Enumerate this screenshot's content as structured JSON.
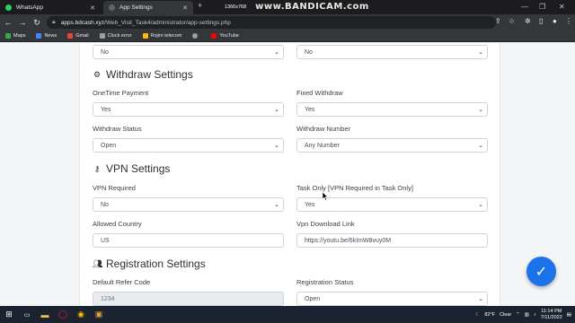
{
  "browser": {
    "tabs": [
      {
        "title": "WhatsApp",
        "active": false,
        "favicon_color": "#25d366"
      },
      {
        "title": "App Settings",
        "active": true,
        "favicon_color": "#5f6368"
      }
    ],
    "new_tab": "+",
    "url_domain": "apps.bdcash.xyz",
    "url_path": "/Web_Visit_Task4/administrator/app-settings.php",
    "bookmarks": [
      {
        "label": "Maps",
        "color": "#34a853"
      },
      {
        "label": "News",
        "color": "#4285f4"
      },
      {
        "label": "Gmail",
        "color": "#ea4335"
      },
      {
        "label": "Clock error",
        "color": "#9aa0a6"
      },
      {
        "label": "Rojim telecom",
        "color": "#fbbc04"
      },
      {
        "label": "",
        "color": "#9aa0a6"
      },
      {
        "label": "YouTube",
        "color": "#ff0000"
      }
    ]
  },
  "recorder": {
    "resolution": "1366x768",
    "brand": "www.BANDICAM.com"
  },
  "top_row": {
    "left_value": "No",
    "right_value": "No"
  },
  "withdraw": {
    "title": "Withdraw Settings",
    "onetime_label": "OneTime Payment",
    "onetime_value": "Yes",
    "fixed_label": "Fixed Withdraw",
    "fixed_value": "Yes",
    "status_label": "Withdraw Status",
    "status_value": "Open",
    "number_label": "Withdraw Number",
    "number_value": "Any Number"
  },
  "vpn": {
    "title": "VPN Settings",
    "required_label": "VPN Required",
    "required_value": "No",
    "task_only_label": "Task Only [VPN Required in Task Only]",
    "task_only_value": "Yes",
    "country_label": "Allowed Country",
    "country_value": "US",
    "download_label": "Vpn Download Link",
    "download_value": "https://youtu.be/6kImW8vuy0M"
  },
  "registration": {
    "title": "Registration Settings",
    "refer_label": "Default Refer Code",
    "refer_value": "1234",
    "status_label": "Registration Status",
    "status_value": "Open"
  },
  "taskbar": {
    "weather": "82°F",
    "weather_desc": "Clear",
    "time": "11:14 PM",
    "date": "7/11/2022"
  },
  "colors": {
    "accent": "#1a73e8",
    "chrome_dark": "#35363a"
  }
}
